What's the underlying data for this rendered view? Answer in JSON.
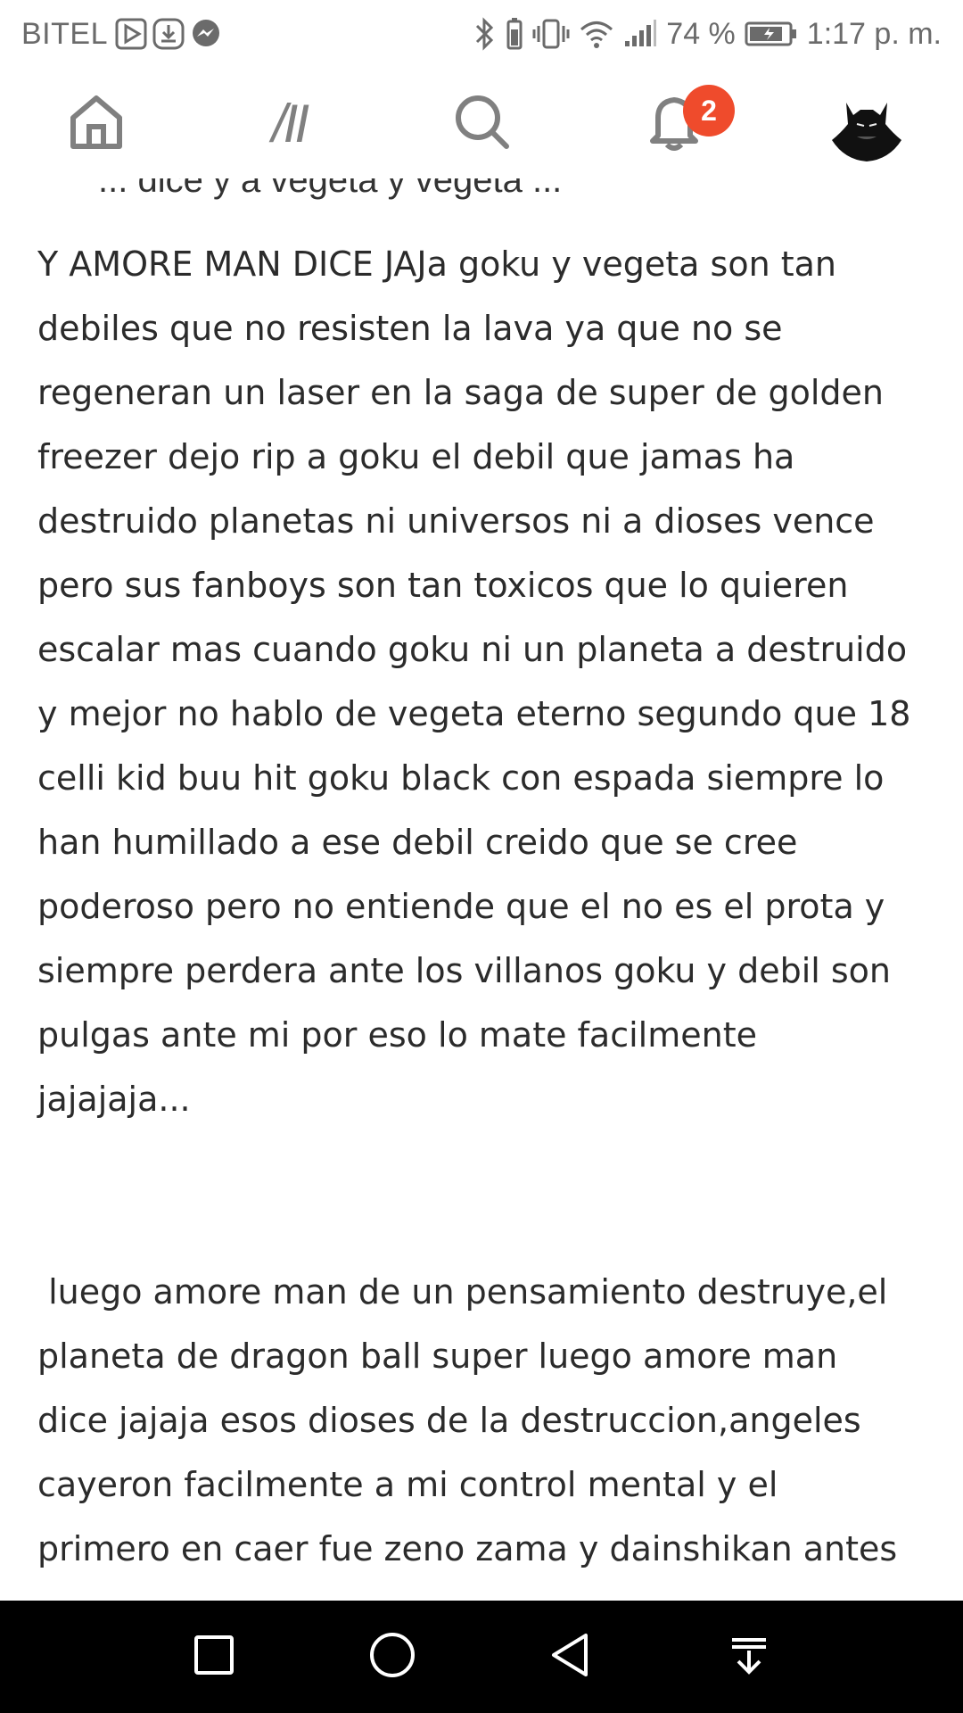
{
  "status_bar": {
    "carrier": "BITEL",
    "battery": "74 %",
    "time": "1:17 p. m.",
    "icons": [
      "play-store-icon",
      "download-icon",
      "messenger-icon",
      "bluetooth-icon",
      "vibrate-icon",
      "wifi-icon",
      "signal-icon",
      "battery-icon"
    ]
  },
  "top_nav": {
    "items": [
      "home-icon",
      "stories-icon",
      "search-icon",
      "notifications-icon",
      "avatar"
    ],
    "stories_glyph": "/II",
    "notification_count": "2"
  },
  "content": {
    "cut_line": "... dice y a vegeta y vegeta ...",
    "paragraph_1": [
      "Y AMORE MAN DICE JAJa goku y vegeta son tan",
      "debiles que no resisten la lava ya que no se",
      "regeneran un laser en la saga de super de golden",
      "freezer dejo rip a goku el debil que jamas ha",
      "destruido planetas ni universos ni a dioses vence",
      "pero sus fanboys son tan toxicos que lo quieren",
      "escalar mas cuando goku ni un planeta a destruido",
      "y mejor no hablo de vegeta eterno segundo que 18",
      "celli kid buu hit goku black con espada siempre lo",
      "han humillado a ese debil creido que se cree",
      "poderoso pero no entiende que el no es el prota y",
      "siempre perdera ante los villanos goku y debil son",
      "pulgas ante mi por eso lo mate facilmente",
      "jajajaja..."
    ],
    "paragraph_2": [
      " luego amore man de un pensamiento destruye,el",
      "planeta de dragon ball super luego amore man",
      "dice jajaja esos dioses de la destruccion,angeles",
      "cayeron facilmente a mi control mental y el",
      "primero en caer fue zeno zama y dainshikan antes"
    ]
  },
  "system_nav": {
    "buttons": [
      "recents-button",
      "home-button",
      "back-button",
      "notifications-pull-button"
    ]
  },
  "colors": {
    "badge": "#ef4b2c",
    "text": "#2b2b2b",
    "icon_gray": "#808080",
    "nav_bar": "#000000"
  }
}
